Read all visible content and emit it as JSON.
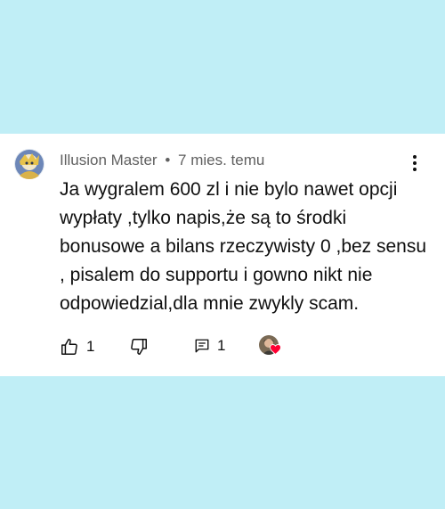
{
  "comment": {
    "author": "Illusion Master",
    "separator": "•",
    "time": "7 mies. temu",
    "text": "Ja wygralem 600 zl i nie bylo nawet opcji wypłaty ,tylko napis,że są to środki bonusowe a bilans rzeczywisty 0 ,bez sensu , pisalem do supportu i gowno nikt nie odpowiedzial,dla mnie zwykly scam.",
    "likes": "1",
    "replies": "1"
  },
  "icons": {
    "more": "more-vertical-icon",
    "like": "thumbs-up-icon",
    "dislike": "thumbs-down-icon",
    "reply": "comment-icon",
    "creator_heart": "heart-icon"
  },
  "colors": {
    "background": "#c0eef6",
    "card": "#ffffff",
    "meta_text": "#606060",
    "text": "#0f0f0f",
    "heart": "#ff0033"
  }
}
